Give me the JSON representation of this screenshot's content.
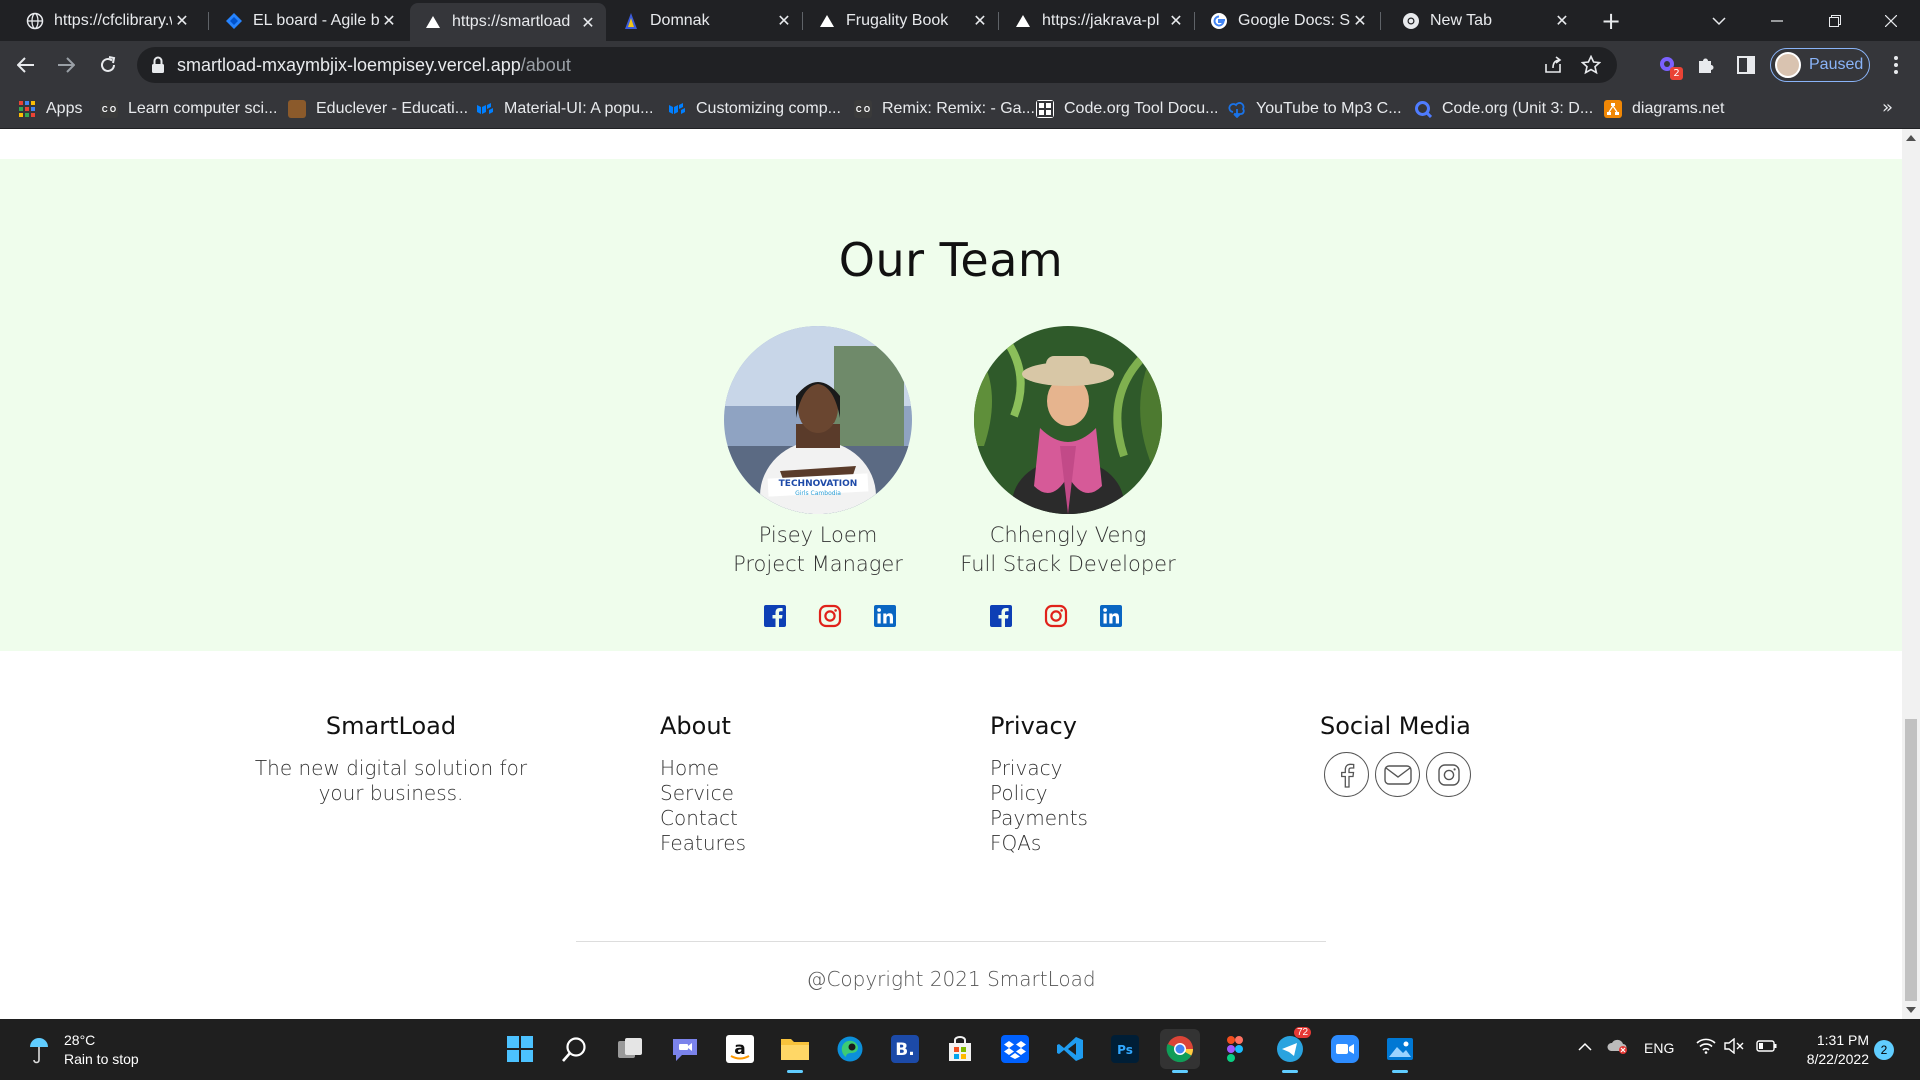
{
  "browser": {
    "tabs": [
      {
        "title": "https://cfclibrary.w",
        "icon": "globe-icon"
      },
      {
        "title": "EL board - Agile b",
        "icon": "jira-icon"
      },
      {
        "title": "https://smartload",
        "icon": "vercel-icon"
      },
      {
        "title": "Domnak",
        "icon": "domnak-icon"
      },
      {
        "title": "Frugality Book",
        "icon": "vercel-icon"
      },
      {
        "title": "https://jakrava-pl",
        "icon": "vercel-icon"
      },
      {
        "title": "Google Docs: Sig",
        "icon": "google-icon"
      },
      {
        "title": "New Tab",
        "icon": "chrome-icon"
      }
    ],
    "active_tab_index": 2,
    "url_host": "smartload-mxaymbjix-loempisey.vercel.app",
    "url_path": "/about",
    "profile_label": "Paused",
    "extension_badge": "2",
    "bookmarks": [
      {
        "label": "Apps",
        "icon": "apps-grid-icon",
        "color": "#ea4335"
      },
      {
        "label": "Learn computer sci...",
        "icon": "codeorg-icon",
        "color": "#3a3a3a"
      },
      {
        "label": "Educlever - Educati...",
        "icon": "educlever-icon",
        "color": "#8b5a2b"
      },
      {
        "label": "Material-UI: A popu...",
        "icon": "mui-icon",
        "color": "#007fff"
      },
      {
        "label": "Customizing comp...",
        "icon": "mui-icon",
        "color": "#007fff"
      },
      {
        "label": "Remix: Remix: - Ga...",
        "icon": "codeorg-icon",
        "color": "#3a3a3a"
      },
      {
        "label": "Code.org Tool Docu...",
        "icon": "codeorg-tool-icon",
        "color": "#ffffff"
      },
      {
        "label": "YouTube to Mp3 C...",
        "icon": "download-icon",
        "color": "#1a73e8"
      },
      {
        "label": "Code.org (Unit 3: D...",
        "icon": "q-icon",
        "color": "#4f7cff"
      },
      {
        "label": "diagrams.net",
        "icon": "drawio-icon",
        "color": "#f08705"
      }
    ]
  },
  "page": {
    "team_title": "Our Team",
    "members": [
      {
        "name": "Pisey Loem",
        "role": "Project Manager",
        "photo_badge": "TECHNOVATION",
        "photo_badge_sub": "Girls Cambodia"
      },
      {
        "name": "Chhengly Veng",
        "role": "Full Stack Developer"
      }
    ],
    "brand_colors": {
      "facebook": "#1877f2",
      "instagram": "#e4405f",
      "linkedin": "#0a66c2",
      "team_bg": "#effdec"
    },
    "footer": {
      "brand": "SmartLoad",
      "tagline": "The new digital solution for your business.",
      "about_title": "About",
      "about_links": [
        "Home",
        "Service",
        "Contact",
        "Features"
      ],
      "privacy_title": "Privacy",
      "privacy_links": [
        "Privacy",
        "Policy",
        "Payments",
        "FQAs"
      ],
      "social_title": "Social Media",
      "copyright": "@Copyright 2021 SmartLoad"
    }
  },
  "taskbar": {
    "temperature": "28°C",
    "weather_text": "Rain to stop",
    "language": "ENG",
    "time": "1:31 PM",
    "date": "8/22/2022",
    "notifications": "2",
    "telegram_badge": "72"
  }
}
